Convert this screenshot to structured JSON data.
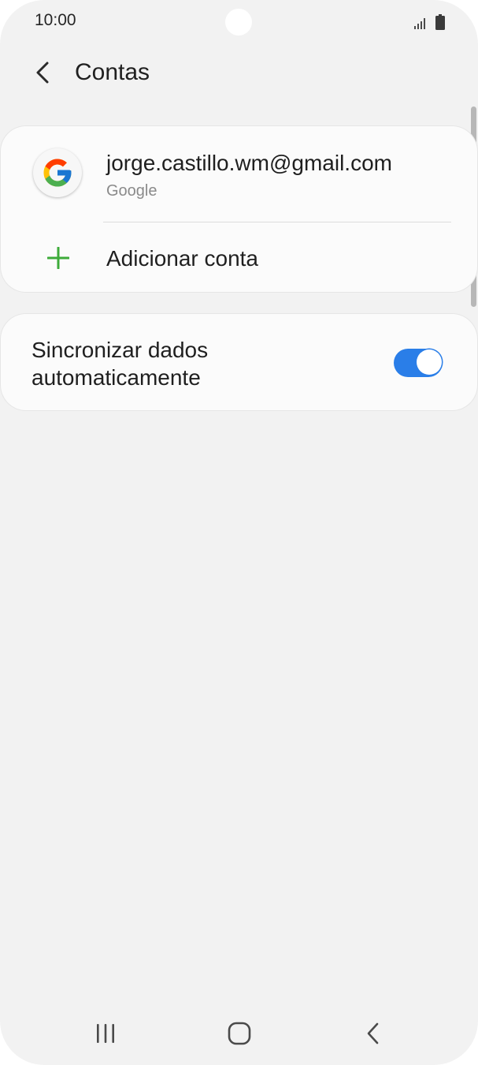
{
  "status_bar": {
    "time": "10:00"
  },
  "header": {
    "title": "Contas"
  },
  "accounts": {
    "items": [
      {
        "email": "jorge.castillo.wm@gmail.com",
        "type": "Google",
        "icon": "google-logo"
      }
    ],
    "add_label": "Adicionar conta",
    "add_icon": "plus-icon"
  },
  "sync": {
    "label": "Sincronizar dados automaticamente",
    "enabled": true
  },
  "colors": {
    "background": "#f2f2f2",
    "card": "#fbfbfb",
    "accent": "#2a7ee8",
    "plus": "#3dab3a"
  },
  "nav": {
    "icons": [
      "recents-icon",
      "home-icon",
      "back-icon"
    ]
  }
}
